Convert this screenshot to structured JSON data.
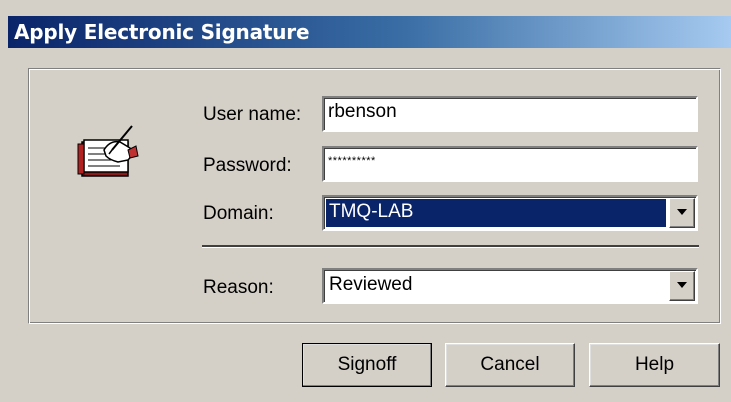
{
  "dialog": {
    "title": "Apply Electronic Signature"
  },
  "form": {
    "username_label": "User name:",
    "username_value": "rbenson",
    "password_label": "Password:",
    "password_value": "**********",
    "domain_label": "Domain:",
    "domain_value": "TMQ-LAB",
    "reason_label": "Reason:",
    "reason_value": "Reviewed"
  },
  "buttons": {
    "signoff": "Signoff",
    "cancel": "Cancel",
    "help": "Help"
  },
  "icons": {
    "signature": "signature-book-icon",
    "dropdown": "chevron-down-icon"
  },
  "colors": {
    "titlebar_start": "#0a246a",
    "titlebar_end": "#a6caf0",
    "dialog_bg": "#d4d0c8",
    "selection": "#0a246a"
  }
}
